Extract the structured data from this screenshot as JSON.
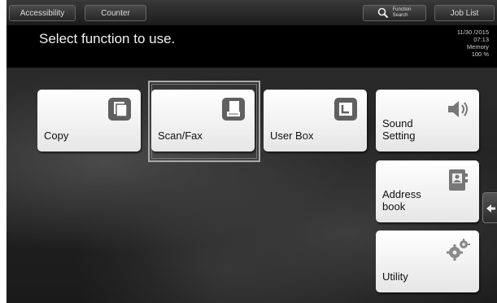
{
  "topbar": {
    "accessibility_label": "Accessibility",
    "counter_label": "Counter",
    "function_search_line1": "Function",
    "function_search_line2": "Search",
    "job_list_label": "Job List"
  },
  "message": "Select function to use.",
  "status": {
    "date": "11/30 /2015",
    "time": "07:13",
    "memory_label": "Memory",
    "memory_value": "100 %"
  },
  "functions": {
    "copy": "Copy",
    "scan_fax": "Scan/Fax",
    "user_box": "User Box"
  },
  "side_functions": {
    "sound_line1": "Sound",
    "sound_line2": "Setting",
    "address_line1": "Address",
    "address_line2": "book",
    "utility": "Utility"
  },
  "colors": {
    "accent_icon": "#555555",
    "tile_bg": "#f4f4f4"
  },
  "icons": {
    "copy": "copy-icon",
    "scan_fax": "scan-fax-icon",
    "user_box": "user-box-icon",
    "sound": "speaker-icon",
    "address": "address-book-icon",
    "utility": "gears-icon"
  }
}
